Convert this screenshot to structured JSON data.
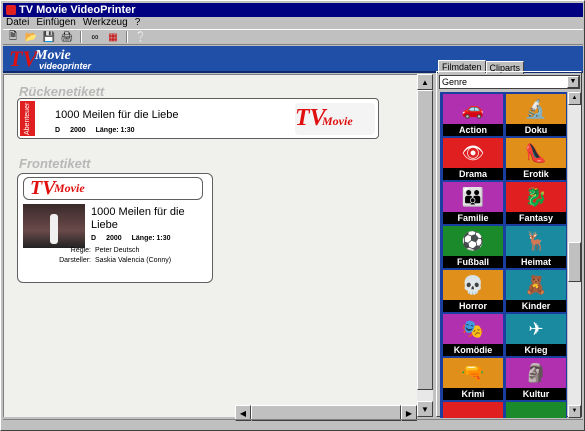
{
  "window": {
    "title": "TV Movie VideoPrinter"
  },
  "menu": [
    "Datei",
    "Einfügen",
    "Werkzeug",
    "?"
  ],
  "toolbar": {
    "icons": [
      "new-icon",
      "open-icon",
      "save-icon",
      "print-icon",
      "line-icon",
      "film-icon",
      "help-icon"
    ]
  },
  "banner": {
    "logo_tv": "TV",
    "logo_movie": "Movie",
    "logo_videoprinter": "videoprinter"
  },
  "back_label": {
    "section": "Rückenetikett",
    "spine": "Abenteuer",
    "title": "1000 Meilen für die Liebe",
    "country": "D",
    "year": "2000",
    "length": "Länge: 1:30",
    "logo_tv": "TV",
    "logo_movie": "Movie"
  },
  "front_label": {
    "section": "Frontetikett",
    "logo_tv": "TV",
    "logo_movie": "Movie",
    "title": "1000 Meilen für die Liebe",
    "country": "D",
    "year": "2000",
    "length": "Länge: 1:30",
    "director_label": "Regie:",
    "director": "Peter Deutsch",
    "cast_label": "Darsteller:",
    "cast": "Saskia Valencia (Conny)"
  },
  "panel": {
    "tabs": [
      "Filmdaten",
      "Cliparts"
    ],
    "active_tab": "Cliparts",
    "genre_select": "Genre",
    "cliparts": [
      {
        "label": "Action",
        "color": "#b030b0",
        "icon": "car-icon",
        "glyph": "🚗"
      },
      {
        "label": "Doku",
        "color": "#e0901a",
        "icon": "microscope-icon",
        "glyph": "🔬"
      },
      {
        "label": "Drama",
        "color": "#e02020",
        "icon": "eye-icon",
        "glyph": "👁"
      },
      {
        "label": "Erotik",
        "color": "#e0901a",
        "icon": "shoe-icon",
        "glyph": "👠"
      },
      {
        "label": "Familie",
        "color": "#b030b0",
        "icon": "family-icon",
        "glyph": "👪"
      },
      {
        "label": "Fantasy",
        "color": "#e02020",
        "icon": "dragon-icon",
        "glyph": "🐉"
      },
      {
        "label": "Fußball",
        "color": "#1a8a2a",
        "icon": "football-icon",
        "glyph": "⚽"
      },
      {
        "label": "Heimat",
        "color": "#1a8aa0",
        "icon": "deer-icon",
        "glyph": "🦌"
      },
      {
        "label": "Horror",
        "color": "#e0901a",
        "icon": "skull-icon",
        "glyph": "💀"
      },
      {
        "label": "Kinder",
        "color": "#1a8aa0",
        "icon": "teddy-icon",
        "glyph": "🧸"
      },
      {
        "label": "Komödie",
        "color": "#b030b0",
        "icon": "mask-icon",
        "glyph": "🎭"
      },
      {
        "label": "Krieg",
        "color": "#1a8aa0",
        "icon": "plane-icon",
        "glyph": "✈"
      },
      {
        "label": "Krimi",
        "color": "#e0901a",
        "icon": "gun-icon",
        "glyph": "🔫"
      },
      {
        "label": "Kultur",
        "color": "#b030b0",
        "icon": "head-icon",
        "glyph": "🗿"
      },
      {
        "label": "",
        "color": "#e02020",
        "icon": "clipart-icon",
        "glyph": ""
      },
      {
        "label": "",
        "color": "#1a8a2a",
        "icon": "clipart-icon",
        "glyph": ""
      }
    ]
  }
}
